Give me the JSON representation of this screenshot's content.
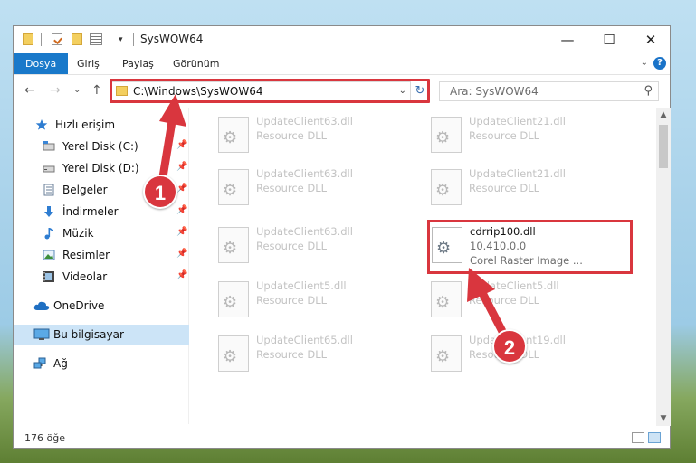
{
  "window": {
    "title": "SysWOW64",
    "controls": {
      "minimize": "—",
      "maximize": "☐",
      "close": "✕"
    }
  },
  "quick_access_toolbar": {
    "dropdown": "▾",
    "icons": [
      "folder-icon",
      "properties-check-icon",
      "new-folder-icon",
      "properties-icon"
    ]
  },
  "ribbon": {
    "tabs": [
      "Dosya",
      "Giriş",
      "Paylaş",
      "Görünüm"
    ],
    "active_tab": "Dosya",
    "expand": "⌄",
    "help": "?",
    "accent": "#1979ca"
  },
  "address_bar": {
    "back": "←",
    "forward": "→",
    "recent": "⌄",
    "up": "↑",
    "path": "C:\\Windows\\SysWOW64",
    "dropdown": "⌄",
    "refresh": "↻",
    "search_placeholder": "Ara: SysWOW64",
    "search_icon": "⚲"
  },
  "sidebar": {
    "items": [
      {
        "label": "Hızlı erişim",
        "icon": "star-icon",
        "pinned": false,
        "selected": false
      },
      {
        "label": "Yerel Disk (C:)",
        "icon": "drive-icon",
        "pinned": true,
        "selected": false
      },
      {
        "label": "Yerel Disk (D:)",
        "icon": "drive-icon",
        "pinned": true,
        "selected": false
      },
      {
        "label": "Belgeler",
        "icon": "documents-icon",
        "pinned": true,
        "selected": false
      },
      {
        "label": "İndirmeler",
        "icon": "downloads-icon",
        "pinned": true,
        "selected": false
      },
      {
        "label": "Müzik",
        "icon": "music-icon",
        "pinned": true,
        "selected": false
      },
      {
        "label": "Resimler",
        "icon": "pictures-icon",
        "pinned": true,
        "selected": false
      },
      {
        "label": "Videolar",
        "icon": "videos-icon",
        "pinned": true,
        "selected": false
      },
      {
        "label": "OneDrive",
        "icon": "cloud-icon",
        "pinned": false,
        "selected": false
      },
      {
        "label": "Bu bilgisayar",
        "icon": "computer-icon",
        "pinned": false,
        "selected": true
      },
      {
        "label": "Ağ",
        "icon": "network-icon",
        "pinned": false,
        "selected": false
      }
    ],
    "pin_glyph": "📌"
  },
  "files": [
    {
      "name": "UpdateClient63.dll",
      "desc": "Resource DLL"
    },
    {
      "name": "UpdateClient21.dll",
      "desc": "Resource DLL"
    },
    {
      "name": "UpdateClient63.dll",
      "desc": "Resource DLL"
    },
    {
      "name": "UpdateClient21.dll",
      "desc": "Resource DLL"
    },
    {
      "name": "UpdateClient63.dll",
      "desc": "Resource DLL"
    },
    {
      "name": "cdrrip100.dll",
      "version": "10.410.0.0",
      "desc": "Corel Raster Image ...",
      "highlighted": true
    },
    {
      "name": "UpdateClient5.dll",
      "desc": "Resource DLL"
    },
    {
      "name": "UpdateClient5.dll",
      "desc": "Resource DLL"
    },
    {
      "name": "UpdateClient65.dll",
      "desc": "Resource DLL"
    },
    {
      "name": "UpdateClient19.dll",
      "desc": "Resource DLL"
    }
  ],
  "scrollbar": {
    "up": "▲",
    "down": "▼"
  },
  "status": {
    "item_count": "176 öğe"
  },
  "annotations": {
    "badge1": "1",
    "badge2": "2",
    "color": "#d9363e"
  }
}
